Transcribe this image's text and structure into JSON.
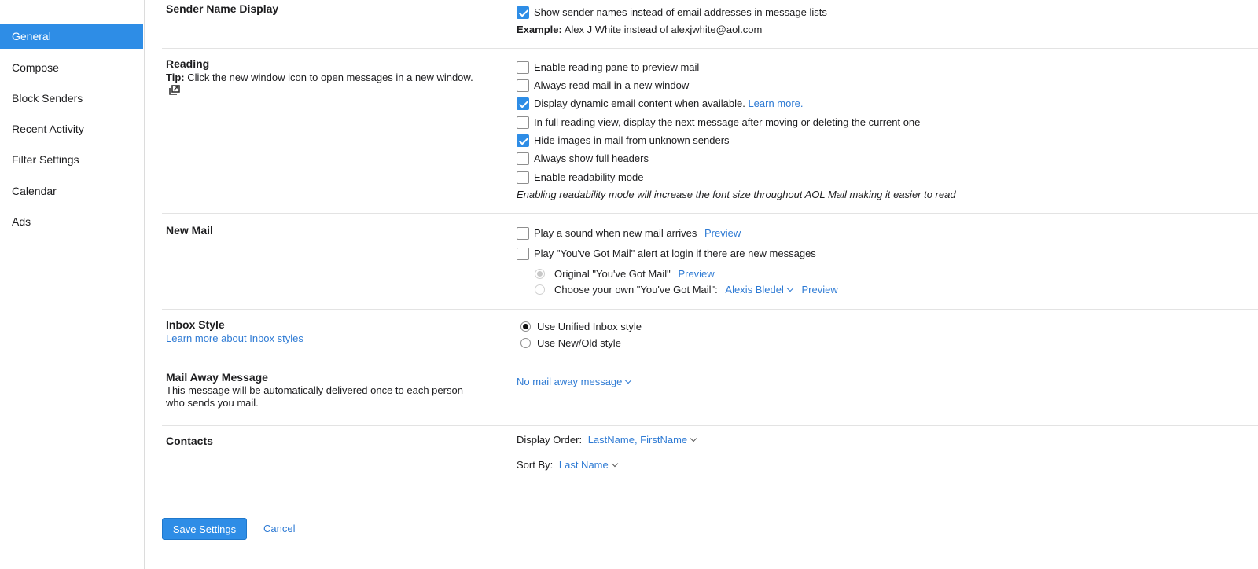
{
  "sidebar": {
    "items": [
      {
        "label": "General",
        "active": true
      },
      {
        "label": "Compose"
      },
      {
        "label": "Block Senders"
      },
      {
        "label": "Recent Activity"
      },
      {
        "label": "Filter Settings"
      },
      {
        "label": "Calendar"
      },
      {
        "label": "Ads"
      }
    ]
  },
  "sender_name": {
    "title": "Sender Name Display",
    "option": "Show sender names instead of email addresses in message lists",
    "example_label": "Example:",
    "example_text": "Alex J White instead of alexjwhite@aol.com"
  },
  "reading": {
    "title": "Reading",
    "tip_label": "Tip:",
    "tip_text": "Click the new window icon to open messages in a new window.",
    "options": [
      {
        "label": "Enable reading pane to preview mail",
        "checked": false
      },
      {
        "label": "Always read mail in a new window",
        "checked": false
      },
      {
        "label": "Display dynamic email content when available.",
        "checked": true,
        "link": "Learn more."
      },
      {
        "label": "In full reading view, display the next message after moving or deleting the current one",
        "checked": false
      },
      {
        "label": "Hide images in mail from unknown senders",
        "checked": true
      },
      {
        "label": "Always show full headers",
        "checked": false
      },
      {
        "label": "Enable readability mode",
        "checked": false
      }
    ],
    "note": "Enabling readability mode will increase the font size throughout AOL Mail making it easier to read"
  },
  "new_mail": {
    "title": "New Mail",
    "sound_label": "Play a sound when new mail arrives",
    "sound_preview": "Preview",
    "alert_label": "Play \"You've Got Mail\" alert at login if there are new messages",
    "original_label": "Original \"You've Got Mail\"",
    "original_preview": "Preview",
    "custom_label": "Choose your own \"You've Got Mail\":",
    "custom_value": "Alexis Bledel",
    "custom_preview": "Preview"
  },
  "inbox_style": {
    "title": "Inbox Style",
    "link": "Learn more about Inbox styles",
    "options": [
      {
        "label": "Use Unified Inbox style",
        "selected": true
      },
      {
        "label": "Use New/Old style",
        "selected": false
      }
    ]
  },
  "mail_away": {
    "title": "Mail Away Message",
    "desc_line1": "This message will be automatically delivered once to each person",
    "desc_line2": "who sends you mail.",
    "value": "No mail away message"
  },
  "contacts": {
    "title": "Contacts",
    "display_order_label": "Display Order:",
    "display_order_value": "LastName, FirstName",
    "sort_by_label": "Sort By:",
    "sort_by_value": "Last Name"
  },
  "actions": {
    "save": "Save Settings",
    "cancel": "Cancel"
  },
  "colors": {
    "accent": "#2e8de6",
    "link": "#2f7bd4"
  }
}
